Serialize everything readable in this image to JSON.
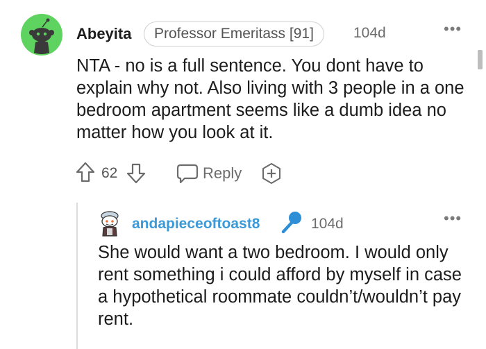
{
  "comment": {
    "author": "Abeyita",
    "flair": "Professor Emeritass [91]",
    "age": "104d",
    "more": "•••",
    "body": "NTA - no is a full sentence. You dont have to explain why not. Also living with 3 people in a one bedroom apartment seems like a dumb idea no matter how you look at it.",
    "score": "62",
    "reply_label": "Reply",
    "avatar_icon": "snoo-avatar-icon",
    "accent_color": "#5fd35f"
  },
  "reply": {
    "author": "andapieceoftoast8",
    "age": "104d",
    "more": "•••",
    "body": "She would want a two bedroom. I would only rent something i could afford by myself in case a hypothetical roommate couldn’t/wouldn’t pay rent.",
    "author_color": "#3d9ad9",
    "badge_icon": "microphone-icon"
  }
}
